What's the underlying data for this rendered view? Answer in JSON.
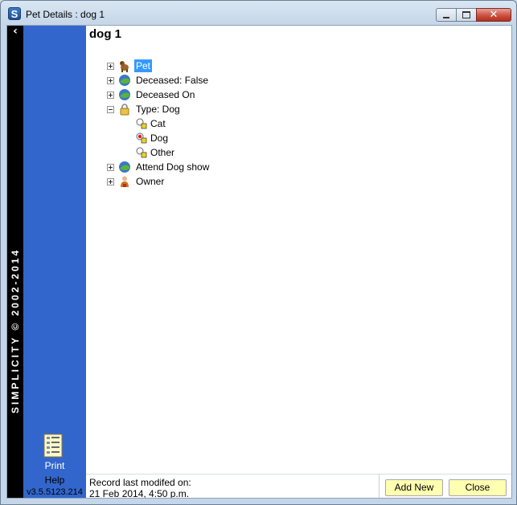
{
  "window": {
    "title": "Pet Details : dog 1",
    "app_icon_letter": "S",
    "controls": {
      "minimize": "minimize",
      "maximize": "maximize",
      "close": "✕"
    }
  },
  "sidebar": {
    "collapse_glyph": "‹",
    "vertical_text": "SIMPLICITY © 2002-2014",
    "print_label": "Print",
    "help_label": "Help",
    "version": "v3.5.5123.214",
    "accent_color": "#3366cc"
  },
  "record": {
    "title": "dog 1"
  },
  "tree": {
    "nodes": [
      {
        "label": "Pet",
        "icon": "dog-icon",
        "expander": "plus",
        "selected": true
      },
      {
        "label": "Deceased:  False",
        "icon": "field-icon",
        "expander": "plus"
      },
      {
        "label": "Deceased On",
        "icon": "field-icon",
        "expander": "plus"
      },
      {
        "label": "Type:  Dog",
        "icon": "lock-icon",
        "expander": "minus",
        "children": [
          {
            "label": "Cat",
            "icon": "radio-lock-icon",
            "checked": false
          },
          {
            "label": "Dog",
            "icon": "radio-lock-icon",
            "checked": true
          },
          {
            "label": "Other",
            "icon": "radio-lock-icon",
            "checked": false
          }
        ]
      },
      {
        "label": "Attend Dog show",
        "icon": "field-icon",
        "expander": "plus"
      },
      {
        "label": "Owner",
        "icon": "person-icon",
        "expander": "plus"
      }
    ]
  },
  "footer": {
    "record_modified_label": "Record last modifed on:",
    "record_modified_date": "21 Feb 2014, 4:50 p.m.",
    "add_new": "Add New",
    "close": "Close",
    "button_color": "#ffffb2"
  }
}
